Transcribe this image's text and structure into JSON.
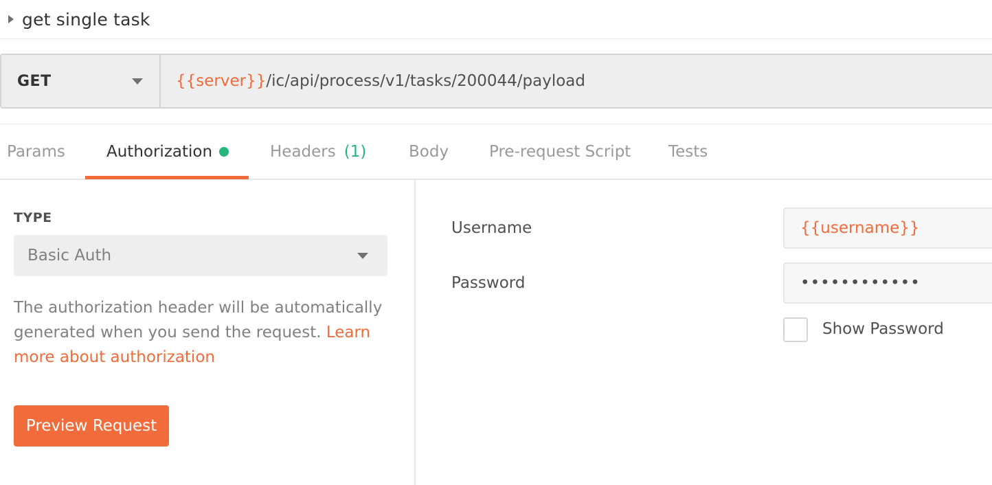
{
  "request": {
    "title": "get single task",
    "method": "GET",
    "url_variable": "{{server}}",
    "url_path": "/ic/api/process/v1/tasks/200044/payload"
  },
  "tabs": [
    {
      "label": "Params"
    },
    {
      "label": "Authorization"
    },
    {
      "label": "Headers",
      "count": "(1)"
    },
    {
      "label": "Body"
    },
    {
      "label": "Pre-request Script"
    },
    {
      "label": "Tests"
    }
  ],
  "active_tab": "Authorization",
  "auth": {
    "type_label": "TYPE",
    "type_value": "Basic Auth",
    "help_text": "The authorization header will be automatically generated when you send the request.",
    "help_link": "Learn more about authorization",
    "preview_button": "Preview Request",
    "username_label": "Username",
    "username_value": "{{username}}",
    "password_label": "Password",
    "password_masked": "••••••••••••",
    "show_password_label": "Show Password"
  },
  "colors": {
    "accent": "#f26b3a",
    "success": "#26b47f"
  }
}
